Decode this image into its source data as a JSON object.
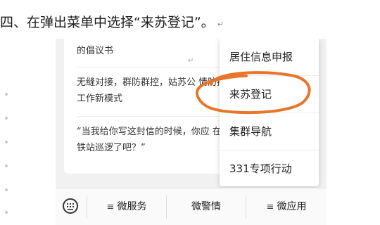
{
  "instruction": {
    "text": "四、在弹出菜单中选择“来苏登记”。",
    "return_mark": "↵"
  },
  "article": {
    "paragraph1": "的倡议书",
    "paragraph2": "无缝对接，群防群控，姑苏公 情防控工作新模式",
    "paragraph3": "“当我给你写这封信的时候，你应 在城铁站巡逻了吧？”"
  },
  "popup_menu": {
    "items": [
      {
        "label": "居住信息申报"
      },
      {
        "label": "来苏登记"
      },
      {
        "label": "集群导航"
      },
      {
        "label": "331专项行动"
      }
    ],
    "highlighted_item": "来苏登记",
    "highlight_color": "#e8752a"
  },
  "tab_bar": {
    "keyboard_icon": "keyboard-icon",
    "menu_icon": "≡",
    "tabs": [
      {
        "label": "微服务",
        "has_menu_icon": true
      },
      {
        "label": "微警情",
        "has_menu_icon": false
      },
      {
        "label": "微应用",
        "has_menu_icon": true
      }
    ]
  }
}
